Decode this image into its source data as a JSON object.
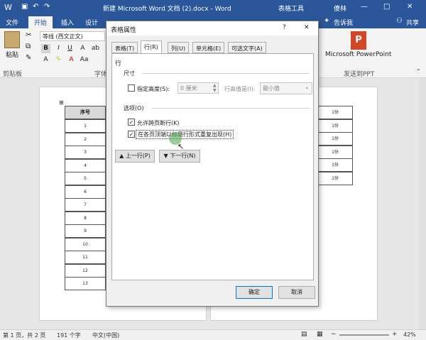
{
  "window": {
    "title": "新建 Microsoft Word 文档 (2).docx - Word",
    "context_tab": "表格工具",
    "user": "傻林"
  },
  "ribbon_tabs": [
    "文件",
    "开始",
    "插入",
    "设计"
  ],
  "tell_me": "告诉我",
  "share": "共享",
  "ribbon": {
    "paste_label": "粘贴",
    "clipboard_group": "剪贴板",
    "font_name": "等线 (西文正文)",
    "font_group_label": "字体",
    "bold": "B",
    "italic": "I",
    "underline": "U",
    "ppt_label": "Microsoft PowerPoint",
    "ppt_group": "发送到PPT"
  },
  "table": {
    "header": "序号",
    "rows": [
      "1",
      "2",
      "3",
      "4",
      "5",
      "6",
      "7",
      "8",
      "9",
      "10",
      "11",
      "12",
      "13"
    ],
    "right_col": [
      "1份",
      "1份",
      "1份",
      "1份",
      "1份",
      "1份"
    ]
  },
  "dialog": {
    "title": "表格属性",
    "help": "?",
    "close": "✕",
    "tabs": [
      "表格(T)",
      "行(R)",
      "列(U)",
      "单元格(E)",
      "可选文字(A)"
    ],
    "section_row": "行",
    "size_label": "尺寸",
    "specify_height": "指定高度(S):",
    "height_value": "0 厘米",
    "row_height_is": "行高值是(I):",
    "row_height_mode": "最小值",
    "options_label": "选项(O)",
    "allow_break": "允许跨页断行(K)",
    "repeat_header": "在各页顶端以标题行形式重复出现(H)",
    "prev_row": "上一行(P)",
    "next_row": "下一行(N)",
    "ok": "确定",
    "cancel": "取消"
  },
  "status": {
    "page": "第 1 页，共 2 页",
    "words": "191 个字",
    "lang": "中文(中国)",
    "zoom": "42%"
  }
}
